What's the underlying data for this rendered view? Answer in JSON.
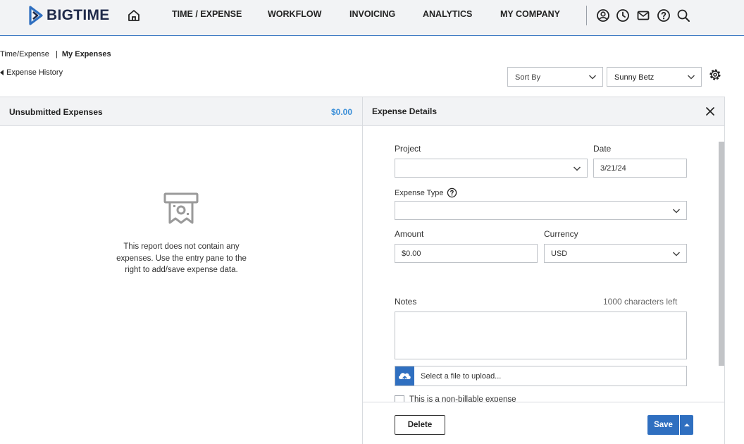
{
  "app": {
    "brand": "BIGTIME"
  },
  "nav": {
    "items": [
      {
        "label": "TIME / EXPENSE"
      },
      {
        "label": "WORKFLOW"
      },
      {
        "label": "INVOICING"
      },
      {
        "label": "ANALYTICS"
      },
      {
        "label": "MY COMPANY"
      }
    ],
    "icons": [
      "home-icon",
      "user-circle-icon",
      "clock-icon",
      "mail-icon",
      "help-circle-icon",
      "search-icon"
    ]
  },
  "breadcrumb": {
    "parent": "Time/Expense",
    "separator": "|",
    "current": "My Expenses"
  },
  "back_link": "Expense History",
  "toolbar": {
    "sort_by": "Sort By",
    "user": "Sunny Betz"
  },
  "left_panel": {
    "title": "Unsubmitted Expenses",
    "total": "$0.00",
    "empty_message": "This report does not contain any expenses. Use the entry pane to the right to add/save expense data."
  },
  "details": {
    "title": "Expense Details",
    "project_label": "Project",
    "project_value": "",
    "date_label": "Date",
    "date_value": "3/21/24",
    "expense_type_label": "Expense Type",
    "expense_type_value": "",
    "amount_label": "Amount",
    "amount_value": "$0.00",
    "currency_label": "Currency",
    "currency_value": "USD",
    "notes_label": "Notes",
    "notes_counter": "1000 characters left",
    "upload_text": "Select a file to upload...",
    "nonbillable_label": "This is a non-billable expense"
  },
  "footer": {
    "delete_label": "Delete",
    "save_label": "Save"
  },
  "colors": {
    "accent": "#2f6fc0",
    "total": "#3b8fd8",
    "brand": "#1f2a4a"
  }
}
